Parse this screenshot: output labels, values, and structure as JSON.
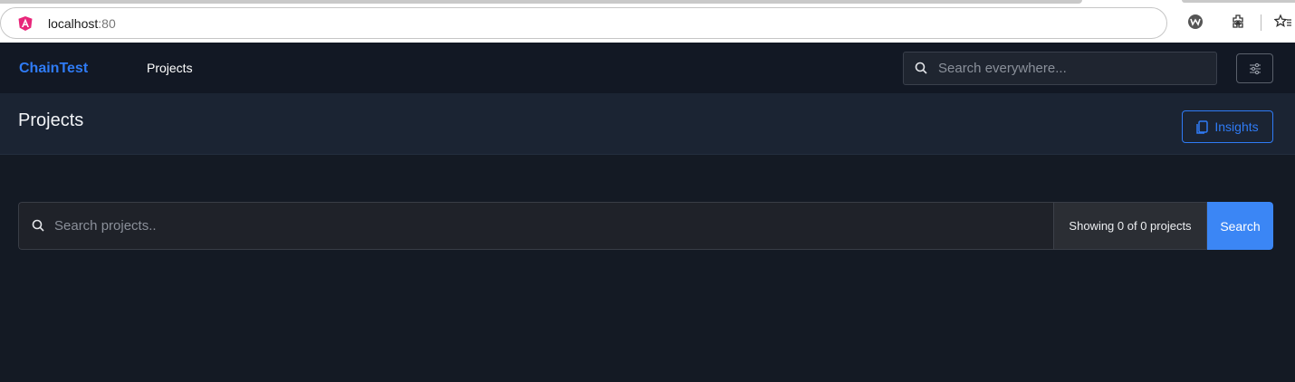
{
  "browser": {
    "url_host": "localhost",
    "url_port": ":80"
  },
  "navbar": {
    "brand": "ChainTest",
    "nav_projects": "Projects",
    "search_placeholder": "Search everywhere...",
    "settings_icon": "sliders-icon"
  },
  "header": {
    "title": "Projects",
    "insights_label": "Insights",
    "insights_icon": "copy-icon"
  },
  "project_search": {
    "placeholder": "Search projects..",
    "count_text": "Showing 0 of 0 projects",
    "button_label": "Search"
  },
  "colors": {
    "brand": "#2f7bf5",
    "background": "#141a24",
    "header_bg": "#1b2433",
    "search_button": "#3b86f5"
  }
}
